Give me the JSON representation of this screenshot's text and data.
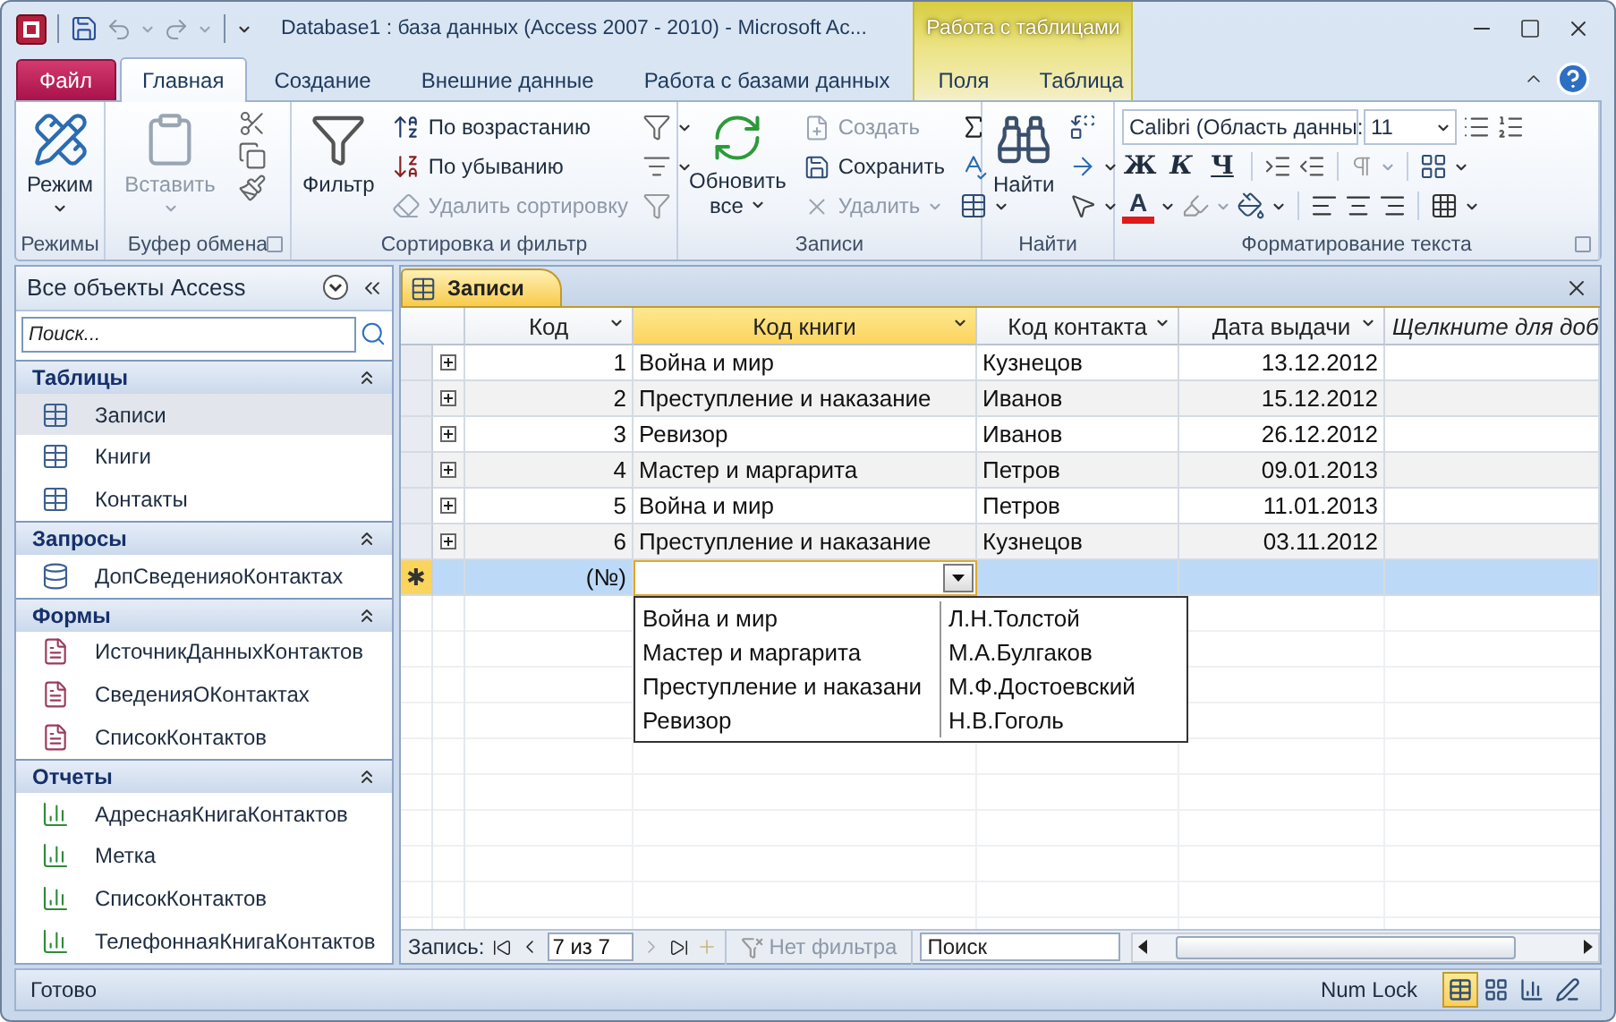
{
  "window": {
    "title": "Database1 : база данных (Access 2007 - 2010)  -  Microsoft Ac...",
    "context_label": "Работа с таблицами"
  },
  "ribbon_tabs": [
    {
      "label": "Файл",
      "kind": "file",
      "selected": false
    },
    {
      "label": "Главная",
      "kind": "main",
      "selected": true
    },
    {
      "label": "Создание",
      "kind": "main",
      "selected": false
    },
    {
      "label": "Внешние данные",
      "kind": "main",
      "selected": false
    },
    {
      "label": "Работа с базами данных",
      "kind": "main",
      "selected": false
    },
    {
      "label": "Поля",
      "kind": "context",
      "selected": false
    },
    {
      "label": "Таблица",
      "kind": "context",
      "selected": false
    }
  ],
  "ribbon_groups": [
    {
      "label": "Режимы",
      "launcher": false,
      "large": [
        {
          "label": "Режим",
          "disabled": false,
          "dropdown": true
        }
      ]
    },
    {
      "label": "Буфер обмена",
      "launcher": true,
      "large": [
        {
          "label": "Вставить",
          "disabled": true,
          "dropdown": true
        }
      ]
    },
    {
      "label": "Сортировка и фильтр",
      "launcher": false,
      "large": [
        {
          "label": "Фильтр",
          "disabled": false,
          "dropdown": false
        }
      ],
      "small": [
        {
          "label": "По возрастанию",
          "disabled": false,
          "dropdown": false
        },
        {
          "label": "По убыванию",
          "disabled": false,
          "dropdown": false
        },
        {
          "label": "Удалить сортировку",
          "disabled": true,
          "dropdown": false
        }
      ]
    },
    {
      "label": "Записи",
      "launcher": false,
      "large": [
        {
          "label": "Обновить все",
          "disabled": false,
          "dropdown": true
        }
      ],
      "small": [
        {
          "label": "Создать",
          "disabled": true,
          "dropdown": false
        },
        {
          "label": "Сохранить",
          "disabled": false,
          "dropdown": false
        },
        {
          "label": "Удалить",
          "disabled": true,
          "dropdown": true
        }
      ]
    },
    {
      "label": "Найти",
      "launcher": false,
      "large": [
        {
          "label": "Найти",
          "disabled": false,
          "dropdown": false
        }
      ]
    },
    {
      "label": "Форматирование текста",
      "launcher": true,
      "font_name": "Calibri (Область данны:",
      "font_size": "11",
      "styles": [
        "Ж",
        "К",
        "Ч"
      ],
      "font_color_letter": "A"
    }
  ],
  "nav": {
    "title": "Все объекты Access",
    "search_placeholder": "Поиск...",
    "sections": [
      {
        "title": "Таблицы",
        "kind": "table",
        "expanded": true,
        "items": [
          {
            "label": "Записи",
            "selected": true
          },
          {
            "label": "Книги",
            "selected": false
          },
          {
            "label": "Контакты",
            "selected": false
          }
        ]
      },
      {
        "title": "Запросы",
        "kind": "query",
        "expanded": true,
        "items": [
          {
            "label": "ДопСведенияоКонтактах",
            "selected": false
          }
        ]
      },
      {
        "title": "Формы",
        "kind": "form",
        "expanded": true,
        "items": [
          {
            "label": "ИсточникДанныхКонтактов",
            "selected": false
          },
          {
            "label": "СведенияОКонтактах",
            "selected": false
          },
          {
            "label": "СписокКонтактов",
            "selected": false
          }
        ]
      },
      {
        "title": "Отчеты",
        "kind": "report",
        "expanded": true,
        "items": [
          {
            "label": "АдреснаяКнигаКонтактов",
            "selected": false
          },
          {
            "label": "Метка",
            "selected": false
          },
          {
            "label": "СписокКонтактов",
            "selected": false
          },
          {
            "label": "ТелефоннаяКнигаКонтактов",
            "selected": false
          }
        ]
      }
    ]
  },
  "document": {
    "tab": "Записи",
    "columns": [
      {
        "label": "Код",
        "kind": "field",
        "selected": false
      },
      {
        "label": "Код книги",
        "kind": "field",
        "selected": true
      },
      {
        "label": "Код контакта",
        "kind": "field",
        "selected": false
      },
      {
        "label": "Дата выдачи",
        "kind": "field",
        "selected": false
      },
      {
        "label": "Щелкните для доб",
        "kind": "add",
        "selected": false
      }
    ],
    "rows": [
      {
        "id": "1",
        "book": "Война и мир",
        "contact": "Кузнецов",
        "date": "13.12.2012"
      },
      {
        "id": "2",
        "book": "Преступление и наказание",
        "contact": "Иванов",
        "date": "15.12.2012"
      },
      {
        "id": "3",
        "book": "Ревизор",
        "contact": "Иванов",
        "date": "26.12.2012"
      },
      {
        "id": "4",
        "book": "Мастер и маргарита",
        "contact": "Петров",
        "date": "09.01.2013"
      },
      {
        "id": "5",
        "book": "Война и мир",
        "contact": "Петров",
        "date": "11.01.2013"
      },
      {
        "id": "6",
        "book": "Преступление и наказание",
        "contact": "Кузнецов",
        "date": "03.11.2012"
      }
    ],
    "new_row": {
      "marker": "✱",
      "id": "(№)",
      "selected": true
    },
    "lookup": [
      {
        "book": "Война и мир",
        "author": "Л.Н.Толстой"
      },
      {
        "book": "Мастер и маргарита",
        "author": "М.А.Булгаков"
      },
      {
        "book": "Преступление и наказани",
        "author": "М.Ф.Достоевский"
      },
      {
        "book": "Ревизор",
        "author": "Н.В.Гоголь"
      }
    ]
  },
  "record_nav": {
    "label": "Запись:",
    "position": "7 из 7",
    "filter": "Нет фильтра",
    "filter_active": false,
    "search_placeholder": "Поиск"
  },
  "status_bar": {
    "text": "Готово",
    "indicator": "Num Lock",
    "views": [
      {
        "selected": true
      },
      {
        "selected": false
      },
      {
        "selected": false
      },
      {
        "selected": false
      }
    ]
  }
}
